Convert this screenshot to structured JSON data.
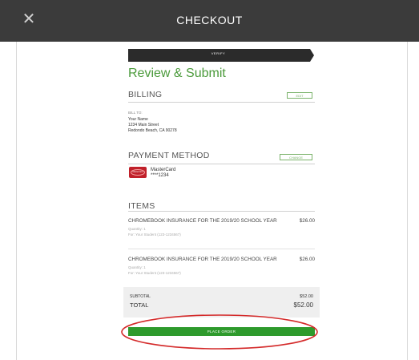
{
  "header": {
    "title": "CHECKOUT",
    "close_icon": "close-icon"
  },
  "progress": {
    "step_label": "VERIFY"
  },
  "page": {
    "title": "Review & Submit"
  },
  "billing": {
    "heading": "BILLING",
    "edit_label": "EDIT",
    "bill_to_label": "BILL TO:",
    "address_lines": [
      "Your Name",
      "1234 Main Street",
      "Redondo Beach, CA 90278"
    ]
  },
  "payment": {
    "heading": "PAYMENT METHOD",
    "change_label": "CHANGE",
    "card_brand": "MasterCard",
    "card_number": "****1234",
    "card_logo_text": "MasterCard",
    "card_color": "#c0202a"
  },
  "items": {
    "heading": "ITEMS",
    "list": [
      {
        "name": "CHROMEBOOK INSURANCE FOR THE 2019/20 SCHOOL YEAR",
        "price": "$26.00",
        "quantity": "Quantity: 1",
        "for": "For: Your Student (123-1234567)"
      },
      {
        "name": "CHROMEBOOK INSURANCE FOR THE 2019/20 SCHOOL YEAR",
        "price": "$26.00",
        "quantity": "Quantity: 1",
        "for": "For: Your Student (123-1234567)"
      }
    ]
  },
  "summary": {
    "subtotal_label": "SUBTOTAL",
    "subtotal_value": "$52.00",
    "total_label": "TOTAL",
    "total_value": "$52.00"
  },
  "actions": {
    "place_order_label": "PLACE ORDER"
  },
  "colors": {
    "header_bg": "#3b3b3b",
    "accent_green": "#2e9a2c",
    "title_green": "#4a9a3a",
    "annotation_red": "#d42a2a"
  }
}
